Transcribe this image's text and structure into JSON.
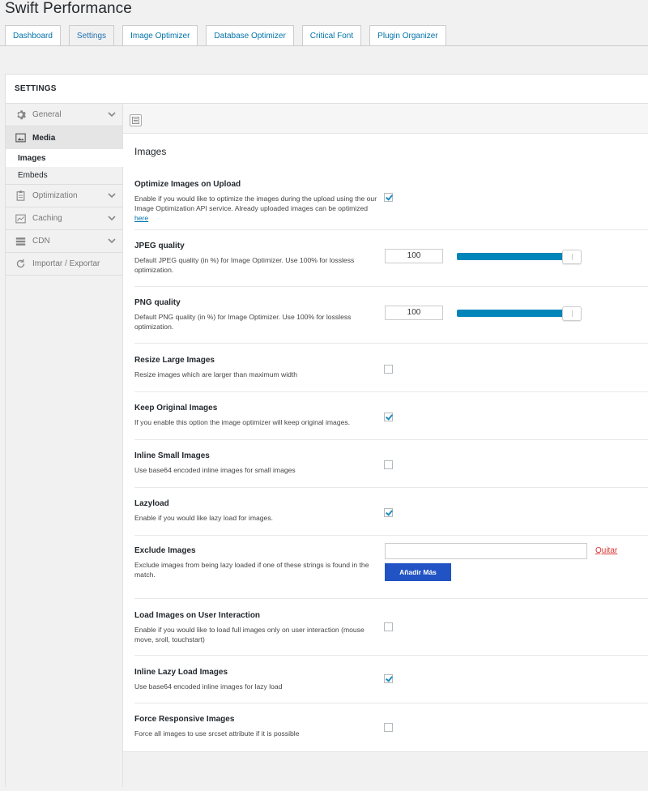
{
  "app": {
    "title": "Swift Performance"
  },
  "tabs": [
    {
      "label": "Dashboard"
    },
    {
      "label": "Settings"
    },
    {
      "label": "Image Optimizer"
    },
    {
      "label": "Database Optimizer"
    },
    {
      "label": "Critical Font"
    },
    {
      "label": "Plugin Organizer"
    }
  ],
  "panel": {
    "title": "SETTINGS"
  },
  "sidebar": {
    "items": [
      {
        "label": "General",
        "icon": "gear-icon"
      },
      {
        "label": "Media",
        "icon": "image-icon"
      },
      {
        "label": "Images"
      },
      {
        "label": "Embeds"
      },
      {
        "label": "Optimization",
        "icon": "clipboard-icon"
      },
      {
        "label": "Caching",
        "icon": "chart-icon"
      },
      {
        "label": "CDN",
        "icon": "server-icon"
      },
      {
        "label": "Importar / Exportar",
        "icon": "refresh-icon"
      }
    ]
  },
  "section": {
    "title": "Images"
  },
  "settings": {
    "optimize_upload": {
      "label": "Optimize Images on Upload",
      "desc": "Enable if you would like to optimize the images during the upload using the our Image Optimization API service. Already uploaded images can be optimized",
      "link": "here",
      "checked": true
    },
    "jpeg_quality": {
      "label": "JPEG quality",
      "desc": "Default JPEG quality (in %) for Image Optimizer. Use 100% for lossless optimization.",
      "value": "100",
      "slider_percent": 100
    },
    "png_quality": {
      "label": "PNG quality",
      "desc": "Default PNG quality (in %) for Image Optimizer. Use 100% for lossless optimization.",
      "value": "100",
      "slider_percent": 100
    },
    "resize_large": {
      "label": "Resize Large Images",
      "desc": "Resize images which are larger than maximum width",
      "checked": false
    },
    "keep_original": {
      "label": "Keep Original Images",
      "desc": "If you enable this option the image optimizer will keep original images.",
      "checked": true
    },
    "inline_small": {
      "label": "Inline Small Images",
      "desc": "Use base64 encoded inline images for small images",
      "checked": false
    },
    "lazyload": {
      "label": "Lazyload",
      "desc": "Enable if you would like lazy load for images.",
      "checked": true
    },
    "exclude_images": {
      "label": "Exclude Images",
      "desc": "Exclude images from being lazy loaded if one of these strings is found in the match.",
      "value": "",
      "remove_label": "Quitar",
      "add_label": "Añadir Más"
    },
    "load_on_interaction": {
      "label": "Load Images on User Interaction",
      "desc": "Enable if you would like to load full images only on user interaction (mouse move, sroll, touchstart)",
      "checked": false
    },
    "inline_lazy": {
      "label": "Inline Lazy Load Images",
      "desc": "Use base64 encoded inline images for lazy load",
      "checked": true
    },
    "force_responsive": {
      "label": "Force Responsive Images",
      "desc": "Force all images to use srcset attribute if it is possible",
      "checked": false
    }
  },
  "colors": {
    "accent": "#0085ba",
    "link": "#0073aa",
    "button": "#2153c4",
    "danger": "#dc3232"
  }
}
